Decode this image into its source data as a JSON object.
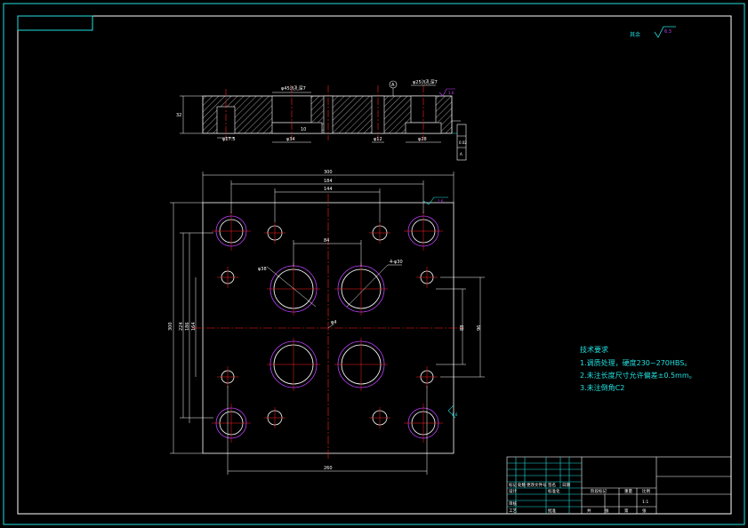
{
  "roughness": {
    "label": "其余",
    "value": "6.3"
  },
  "section": {
    "dims": {
      "counterbore_top": "φ45沉孔深7",
      "height": "32",
      "hole_a": "φ17.5",
      "bore_top_depth": "10",
      "bore_bottom": "φ34",
      "thru": "φ12",
      "right_top": "φ25沉孔深7",
      "right_bottom": "φ28",
      "rough_right": "1.6"
    },
    "datum": "A",
    "tolerance": [
      "0.02",
      "A"
    ]
  },
  "plan": {
    "overall_width": "300",
    "hole_span_top": "184",
    "hole_span_mid": "144",
    "center_span": "84",
    "outer_height": "300",
    "left_dim_1": "224",
    "left_dim_2": "186",
    "left_dim_3": "164",
    "right_dim_1": "96",
    "right_dim_2": "88",
    "bottom_width": "260",
    "bore_label": "4-φ30",
    "bore_label_2": "φ38",
    "center_label": "φ4",
    "rough_label": "1.6",
    "rough_side": "1.6"
  },
  "notes": {
    "title": "技术要求",
    "items": [
      "1.调质处理，硬度230~270HBS。",
      "2.未注长度尺寸允许偏差±0.5mm。",
      "3.未注倒角C2"
    ]
  },
  "title_block": {
    "cells": [
      "标记",
      "处数",
      "更改文件号",
      "签名",
      "日期",
      "设计",
      "标准化",
      "阶段标记",
      "重量",
      "比例",
      "审核",
      "工艺",
      "批准",
      "共",
      "张",
      "第",
      "张",
      "1:1"
    ]
  },
  "colors": {
    "frame": "#ffffff",
    "outline": "#ffffff",
    "centerline": "#ff2020",
    "hole": "#ffffff",
    "hole_outer": "#c040ff",
    "dimension": "#ffffff",
    "annotation": "#22e0e0",
    "hatch": "#ffffff"
  }
}
